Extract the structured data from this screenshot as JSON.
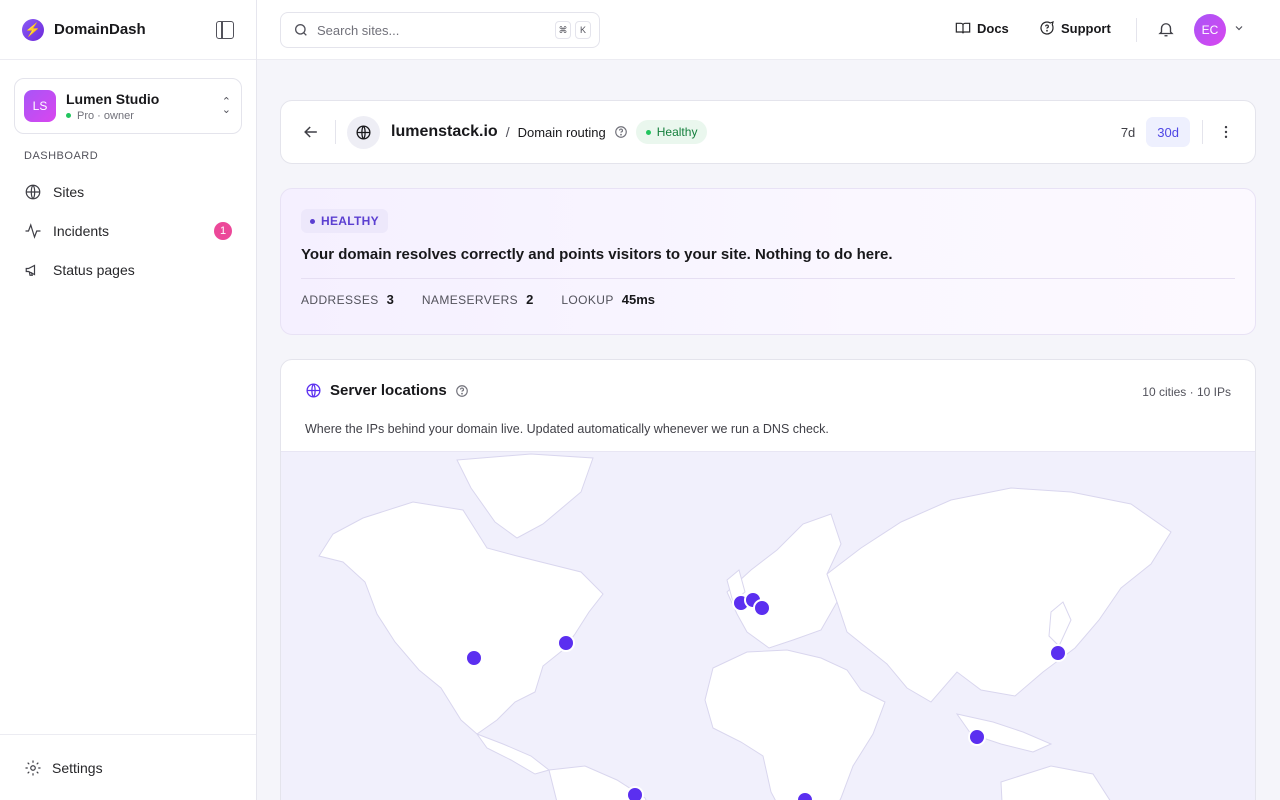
{
  "brand": {
    "name": "DomainDash",
    "logo_icon": "bolt-icon",
    "accent": "#7c3aed"
  },
  "workspace": {
    "initials": "LS",
    "name": "Lumen Studio",
    "meta": "Pro · owner"
  },
  "nav": {
    "heading": "DASHBOARD",
    "items": [
      {
        "label": "Sites",
        "icon": "globe-icon"
      },
      {
        "label": "Incidents",
        "icon": "activity-icon",
        "badge": "1"
      },
      {
        "label": "Status pages",
        "icon": "megaphone-icon"
      }
    ],
    "settings_label": "Settings"
  },
  "topbar": {
    "search_placeholder": "Search sites...",
    "shortcut_keys": [
      "⌘",
      "K"
    ],
    "docs_label": "Docs",
    "support_label": "Support",
    "user_initials": "EC"
  },
  "header": {
    "domain": "lumenstack.io",
    "separator": "/",
    "section": "Domain routing",
    "status": "Healthy",
    "ranges": [
      "7d",
      "30d"
    ],
    "active_range": "30d"
  },
  "health": {
    "tag": "HEALTHY",
    "message": "Your domain resolves correctly and points visitors to your site. Nothing to do here.",
    "stats": [
      {
        "label": "ADDRESSES",
        "value": "3"
      },
      {
        "label": "NAMESERVERS",
        "value": "2"
      },
      {
        "label": "LOOKUP",
        "value": "45ms"
      }
    ]
  },
  "locations": {
    "title": "Server locations",
    "summary": "10 cities · 10 IPs",
    "description": "Where the IPs behind your domain live. Updated automatically whenever we run a DNS check.",
    "marker_color": "#5b2ff0"
  }
}
